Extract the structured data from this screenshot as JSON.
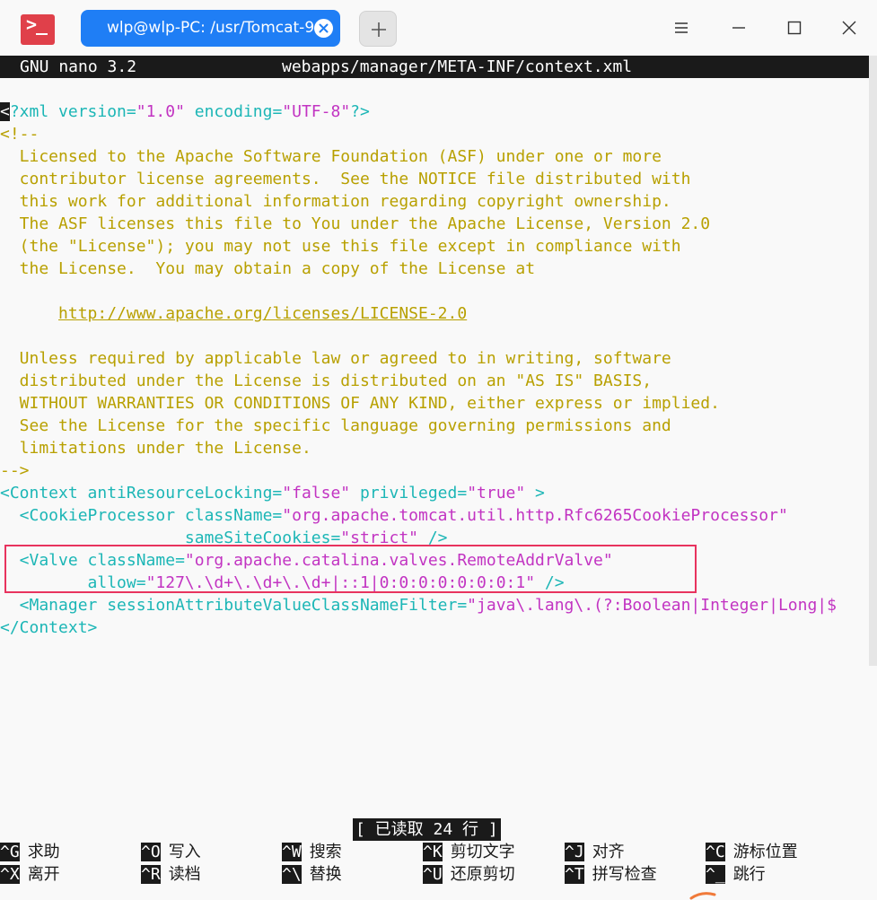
{
  "window": {
    "tab_title": "wlp@wlp-PC: /usr/Tomcat-9",
    "icons": {
      "app": "terminal-app-icon",
      "tab_close": "close-icon",
      "new_tab": "plus-icon",
      "menu": "hamburger-menu-icon",
      "minimize": "minimize-icon",
      "maximize": "maximize-icon",
      "close": "close-icon"
    }
  },
  "nano": {
    "version": "GNU nano 3.2",
    "filename": "webapps/manager/META-INF/context.xml",
    "status": "[ 已读取 24 行 ]"
  },
  "file": {
    "line1": {
      "cursor": "<",
      "pi": "?xml ",
      "a1": "version=",
      "v1": "\"1.0\"",
      "a2": " encoding=",
      "v2": "\"UTF-8\"",
      "end": "?>"
    },
    "comment_open": "<!--",
    "license": [
      "  Licensed to the Apache Software Foundation (ASF) under one or more",
      "  contributor license agreements.  See the NOTICE file distributed with",
      "  this work for additional information regarding copyright ownership.",
      "  The ASF licenses this file to You under the Apache License, Version 2.0",
      "  (the \"License\"); you may not use this file except in compliance with",
      "  the License.  You may obtain a copy of the License at"
    ],
    "url_indent": "      ",
    "url": "http://www.apache.org/licenses/LICENSE-2.0",
    "license2": [
      "  Unless required by applicable law or agreed to in writing, software",
      "  distributed under the License is distributed on an \"AS IS\" BASIS,",
      "  WITHOUT WARRANTIES OR CONDITIONS OF ANY KIND, either express or implied.",
      "  See the License for the specific language governing permissions and",
      "  limitations under the License."
    ],
    "comment_close": "-->",
    "context": {
      "t": "<Context antiResourceLocking=",
      "v1": "\"false\"",
      "a2": " privileged=",
      "v2": "\"true\"",
      "end": " >"
    },
    "cookie": {
      "t": "  <CookieProcessor className=",
      "v": "\"org.apache.tomcat.util.http.Rfc6265CookieProcessor\""
    },
    "cookie2": {
      "t": "                   sameSiteCookies=",
      "v": "\"strict\"",
      "end": " />"
    },
    "valve": {
      "t": "  <Valve className=",
      "v": "\"org.apache.catalina.valves.RemoteAddrValve\""
    },
    "valve2": {
      "t": "         allow=",
      "v": "\"127\\.\\d+\\.\\d+\\.\\d+|::1|0:0:0:0:0:0:0:1\"",
      "end": " />"
    },
    "manager": {
      "t": "  <Manager sessionAttributeValueClassNameFilter=",
      "v": "\"java\\.lang\\.(?:Boolean|Integer|Long|$"
    },
    "context_close": "</Context>"
  },
  "shortcuts": [
    {
      "key": "^G",
      "label": "求助"
    },
    {
      "key": "^O",
      "label": "写入"
    },
    {
      "key": "^W",
      "label": "搜索"
    },
    {
      "key": "^K",
      "label": "剪切文字"
    },
    {
      "key": "^J",
      "label": "对齐"
    },
    {
      "key": "^C",
      "label": "游标位置"
    },
    {
      "key": "^X",
      "label": "离开"
    },
    {
      "key": "^R",
      "label": "读档"
    },
    {
      "key": "^\\",
      "label": "替换"
    },
    {
      "key": "^U",
      "label": "还原剪切"
    },
    {
      "key": "^T",
      "label": "拼写检查"
    },
    {
      "key": "^_",
      "label": "跳行"
    }
  ],
  "colors": {
    "tab": "#1f7ef5",
    "comment": "#b8a000",
    "tag": "#1cb6b6",
    "string": "#c234c2",
    "highlight": "#e8335e",
    "header_bg": "#1a1a1a"
  }
}
